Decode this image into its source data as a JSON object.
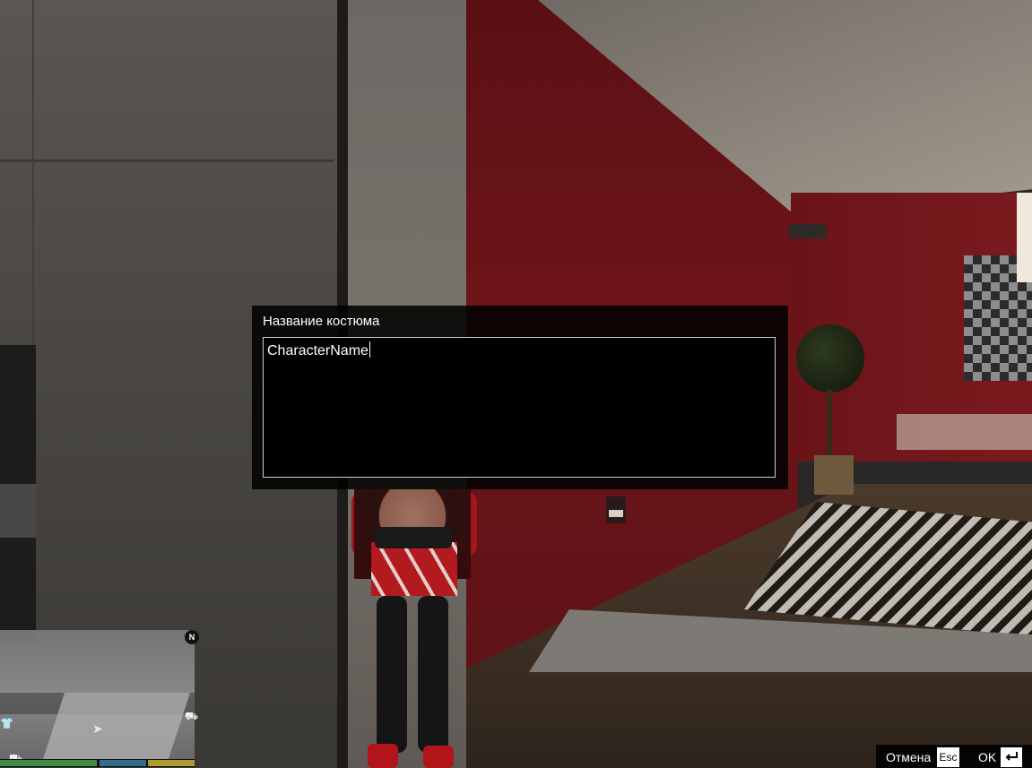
{
  "dialog": {
    "title": "Название костюма",
    "input_value": "CharacterName"
  },
  "minimap": {
    "north_label": "N"
  },
  "hud_bars": {
    "health_fraction": 1.0,
    "armor_fraction": 1.0,
    "special_fraction": 1.0,
    "colors": {
      "health": "#3e8d47",
      "armor": "#2e6f8c",
      "special": "#b09a2a"
    }
  },
  "instructional_buttons": {
    "cancel_label": "Отмена",
    "cancel_key": "Esc",
    "ok_label": "OK",
    "ok_key_icon": "enter-key-icon"
  }
}
